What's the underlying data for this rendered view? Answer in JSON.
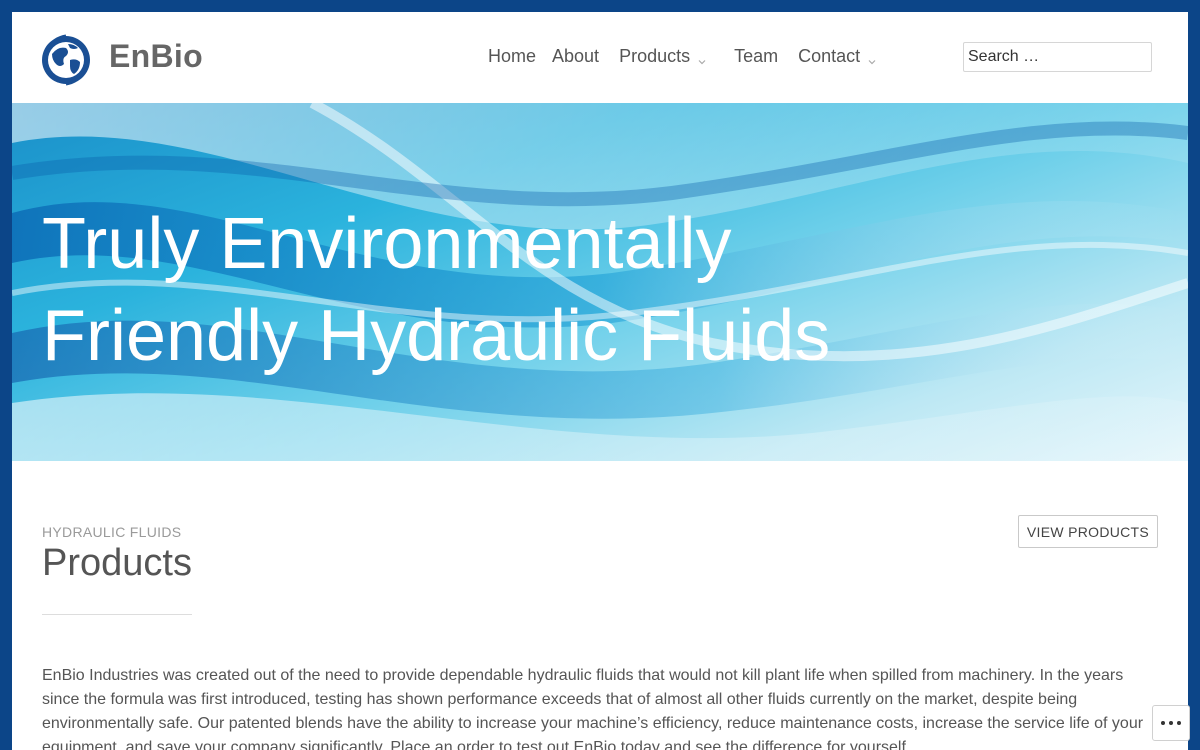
{
  "site": {
    "title": "EnBio",
    "logo_icon": "globe-icon"
  },
  "nav": {
    "items": [
      {
        "label": "Home",
        "has_submenu": false
      },
      {
        "label": "About",
        "has_submenu": false
      },
      {
        "label": "Products",
        "has_submenu": true
      },
      {
        "label": "Team",
        "has_submenu": false
      },
      {
        "label": "Contact",
        "has_submenu": true
      }
    ]
  },
  "search": {
    "placeholder": "Search …"
  },
  "hero": {
    "title": "Truly Environmentally Friendly Hydraulic Fluids"
  },
  "content": {
    "kicker": "HYDRAULIC FLUIDS",
    "heading": "Products",
    "view_button_label": "VIEW PRODUCTS",
    "body": "EnBio Industries was created out of the need to provide dependable hydraulic fluids that would not kill plant life when spilled from machinery. In the years since the formula was first introduced, testing has shown performance exceeds that of almost all other fluids currently on the market, despite being environmentally safe. Our patented blends have the ability to increase your machine’s efficiency, reduce maintenance costs, increase the service life of your equipment, and save your company significantly. Place an order to test out EnBio today and see the difference for yourself."
  },
  "colors": {
    "frame": "#0c4588",
    "logo_blue": "#1a4f94",
    "text": "#555555"
  },
  "more_button_icon": "ellipsis-icon"
}
